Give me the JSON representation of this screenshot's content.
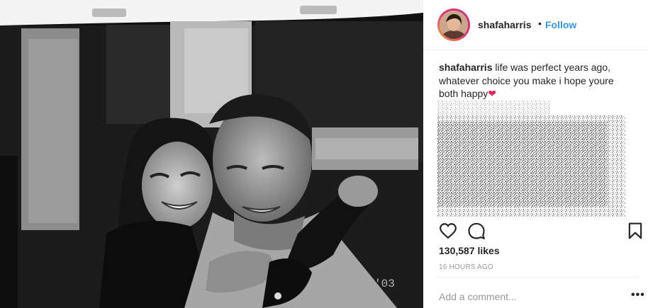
{
  "post": {
    "username": "shafaharris",
    "separator": "•",
    "follow_label": "Follow",
    "caption_username": "shafaharris",
    "caption_text": " life was perfect years ago, whatever choice you make i hope youre both happy",
    "caption_emoji": "❤",
    "likes": "130,587 likes",
    "time": "16 HOURS AGO",
    "comment_placeholder": "Add a comment...",
    "more_label": "•••",
    "photo_stamp": "'03"
  },
  "icons": {
    "like": "heart-outline-icon",
    "comment": "speech-bubble-icon",
    "save": "bookmark-icon",
    "more": "ellipsis-icon"
  },
  "colors": {
    "accent": "#3897f0",
    "text": "#262626",
    "muted": "#999999",
    "heart": "#e91e63"
  }
}
